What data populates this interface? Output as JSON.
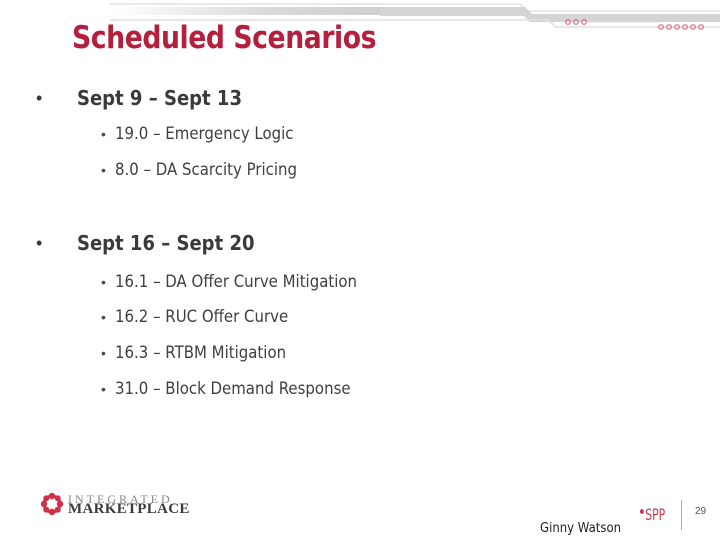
{
  "slide": {
    "title": "Scheduled Scenarios",
    "sections": [
      {
        "heading": "Sept 9 – Sept 13",
        "items": [
          "19.0 – Emergency Logic",
          "8.0 – DA Scarcity Pricing"
        ]
      },
      {
        "heading": "Sept 16 – Sept 20",
        "items": [
          "16.1 – DA Offer Curve Mitigation",
          "16.2 – RUC Offer Curve",
          "16.3 – RTBM Mitigation",
          "31.0 – Block Demand Response"
        ]
      }
    ],
    "bullet_l1": "•",
    "bullet_l2": "•"
  },
  "footer": {
    "logo_line1": "INTEGRATED",
    "logo_line2": "MARKETPLACE",
    "presenter": "Ginny Watson",
    "org_logo": "SPP",
    "page_number": "29"
  },
  "colors": {
    "title": "#b41f3d",
    "accent": "#c8374d",
    "text": "#3a3a3a"
  }
}
